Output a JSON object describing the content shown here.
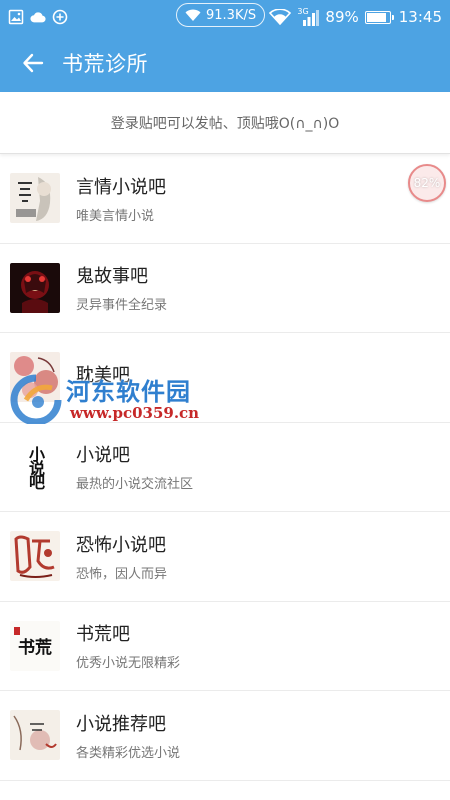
{
  "status_bar": {
    "net_speed": "91.3K/S",
    "network": "3G",
    "battery": "89%",
    "battery_level": 0.89,
    "time": "13:45"
  },
  "app_bar": {
    "title": "书荒诊所"
  },
  "login_tip": "登录贴吧可以发帖、顶贴哦O(∩_∩)O",
  "progress_badge": "82%",
  "forums": [
    {
      "name": "言情小说吧",
      "desc": "唯美言情小说"
    },
    {
      "name": "鬼故事吧",
      "desc": "灵异事件全纪录"
    },
    {
      "name": "耽美吧",
      "desc": ""
    },
    {
      "name": "小说吧",
      "desc": "最热的小说交流社区"
    },
    {
      "name": "恐怖小说吧",
      "desc": "恐怖，因人而异"
    },
    {
      "name": "书荒吧",
      "desc": "优秀小说无限精彩"
    },
    {
      "name": "小说推荐吧",
      "desc": "各类精彩优选小说"
    }
  ],
  "thumb_labels": {
    "xiaoshuo": "小说吧",
    "shuhuang": "书荒"
  },
  "watermark": {
    "title": "河东软件园",
    "url": "www.pc0359.cn"
  }
}
